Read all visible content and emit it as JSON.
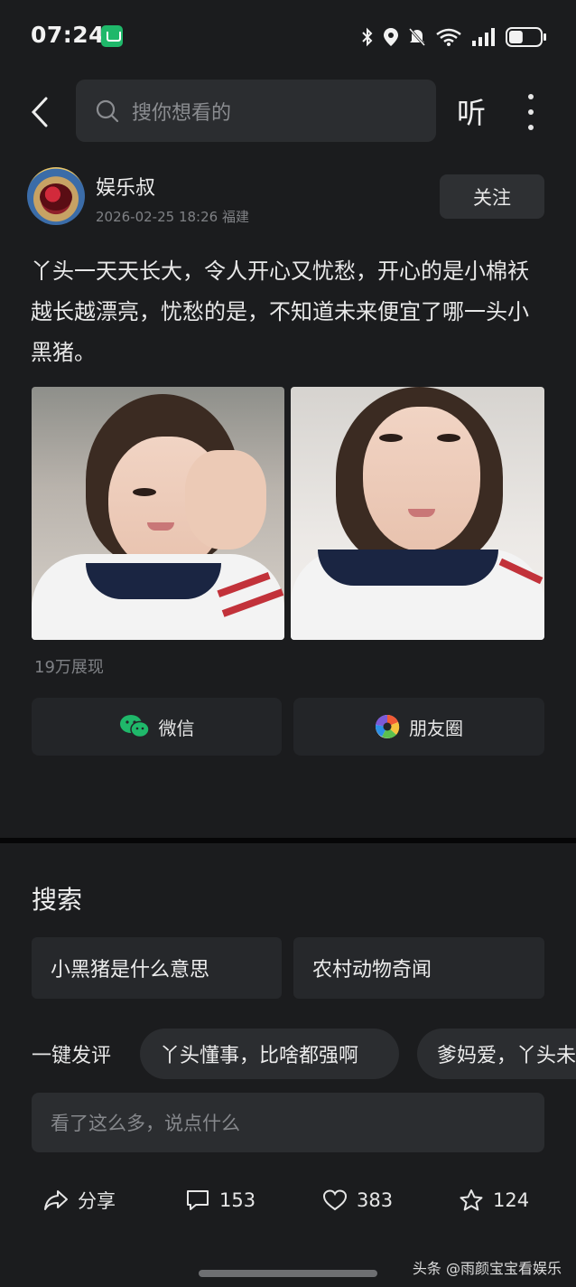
{
  "status_bar": {
    "time": "07:24",
    "battery_level": 0.45
  },
  "top_bar": {
    "search_placeholder": "搜你想看的",
    "listen_label": "听"
  },
  "author": {
    "name": "娱乐叔",
    "date": "2026-02-25 18:26",
    "location": "福建",
    "follow_label": "关注"
  },
  "article": {
    "text": "丫头一天天长大，令人开心又忧愁，开心的是小棉袄越长越漂亮，忧愁的是，不知道未来便宜了哪一头小黑猪。",
    "views": "19万展现"
  },
  "share": {
    "wechat_label": "微信",
    "moments_label": "朋友圈"
  },
  "search_section": {
    "title": "搜索",
    "suggestions": [
      "小黑猪是什么意思",
      "农村动物奇闻"
    ]
  },
  "quick_comment": {
    "label": "一键发评",
    "chips": [
      "丫头懂事，比啥都强啊",
      "爹妈爱，丫头未"
    ]
  },
  "comment_input": {
    "placeholder": "看了这么多，说点什么"
  },
  "actions": {
    "share_label": "分享",
    "comments": "153",
    "likes": "383",
    "favorites": "124"
  },
  "watermark": "头条 @雨颜宝宝看娱乐",
  "colors": {
    "background": "#1b1c1e",
    "card": "#26282b",
    "wechat_green": "#1fb86a"
  }
}
